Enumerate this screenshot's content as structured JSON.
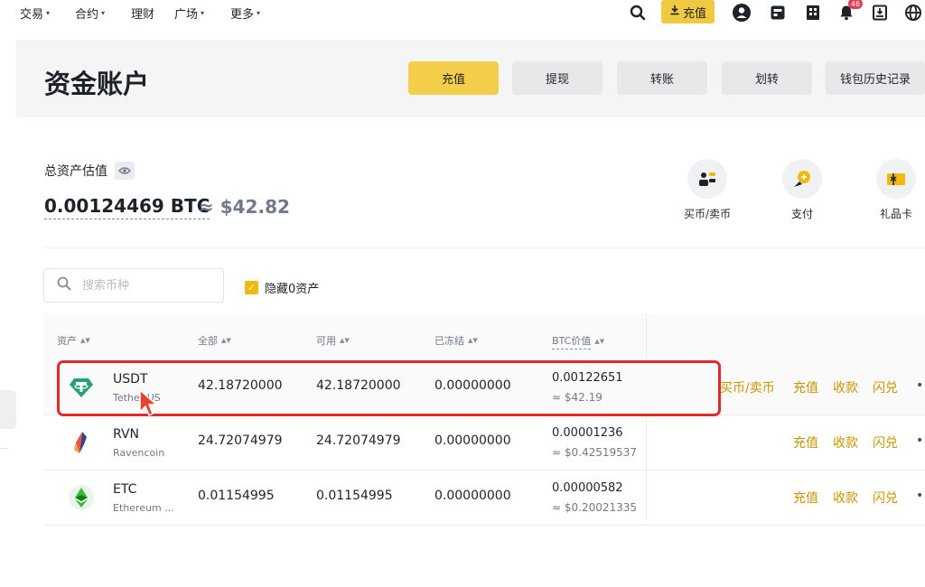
{
  "nav": {
    "items": [
      "交易",
      "合约",
      "理财",
      "广场",
      "更多"
    ],
    "deposit_label": "充值",
    "notification_count": "46"
  },
  "header": {
    "title": "资金账户",
    "buttons": [
      "充值",
      "提现",
      "转账",
      "划转",
      "钱包历史记录"
    ]
  },
  "balance": {
    "label": "总资产估值",
    "btc": "0.00124469 BTC",
    "usd": "≈ $42.82"
  },
  "quick_actions": [
    "买币/卖币",
    "支付",
    "礼品卡"
  ],
  "search": {
    "placeholder": "搜索币种"
  },
  "hide_zero": {
    "label": "隐藏0资产",
    "checked": true
  },
  "table": {
    "columns": [
      "资产",
      "全部",
      "可用",
      "已冻结",
      "BTC价值"
    ],
    "rows": [
      {
        "symbol": "USDT",
        "name": "Tether US",
        "total": "42.18720000",
        "available": "42.18720000",
        "frozen": "0.00000000",
        "btc_value": "0.00122651",
        "usd_value": "≈ $42.19",
        "actions": [
          "买币/卖币",
          "充值",
          "收款",
          "闪兑"
        ]
      },
      {
        "symbol": "RVN",
        "name": "Ravencoin",
        "total": "24.72074979",
        "available": "24.72074979",
        "frozen": "0.00000000",
        "btc_value": "0.00001236",
        "usd_value": "≈ $0.42519537",
        "actions": [
          "充值",
          "收款",
          "闪兑"
        ]
      },
      {
        "symbol": "ETC",
        "name": "Ethereum ...",
        "total": "0.01154995",
        "available": "0.01154995",
        "frozen": "0.00000000",
        "btc_value": "0.00000582",
        "usd_value": "≈ $0.20021335",
        "actions": [
          "充值",
          "收款",
          "闪兑"
        ]
      }
    ]
  },
  "colors": {
    "accent": "#F0B90B",
    "action_text": "#C99400",
    "highlight_border": "#E02A2A"
  }
}
